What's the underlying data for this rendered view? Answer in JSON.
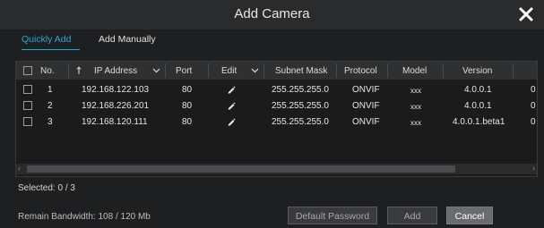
{
  "window": {
    "title": "Add Camera"
  },
  "tabs": [
    {
      "label": "Quickly Add",
      "active": true
    },
    {
      "label": "Add Manually",
      "active": false
    }
  ],
  "table": {
    "columns": [
      "No.",
      "IP Address",
      "Port",
      "Edit",
      "Subnet Mask",
      "Protocol",
      "Model",
      "Version"
    ],
    "rows": [
      {
        "no": "1",
        "ip": "192.168.122.103",
        "port": "80",
        "mask": "255.255.255.0",
        "protocol": "ONVIF",
        "model": "xxx",
        "version": "4.0.0.1",
        "overflow": "0"
      },
      {
        "no": "2",
        "ip": "192.168.226.201",
        "port": "80",
        "mask": "255.255.255.0",
        "protocol": "ONVIF",
        "model": "xxx",
        "version": "4.0.0.1",
        "overflow": "0"
      },
      {
        "no": "3",
        "ip": "192.168.120.111",
        "port": "80",
        "mask": "255.255.255.0",
        "protocol": "ONVIF",
        "model": "xxx",
        "version": "4.0.0.1.beta1",
        "overflow": "0"
      }
    ]
  },
  "status": {
    "selected": "Selected: 0 / 3",
    "bandwidth": "Remain Bandwidth: 108 / 120 Mb"
  },
  "buttons": {
    "default_password": "Default Password",
    "add": "Add",
    "cancel": "Cancel"
  },
  "colors": {
    "accent": "#2aa6d6",
    "background": "#1e1f21"
  },
  "icons": {
    "close": "close-icon",
    "sort": "sort-arrow-icon",
    "dropdown": "chevron-down-icon",
    "edit": "pencil-icon"
  }
}
